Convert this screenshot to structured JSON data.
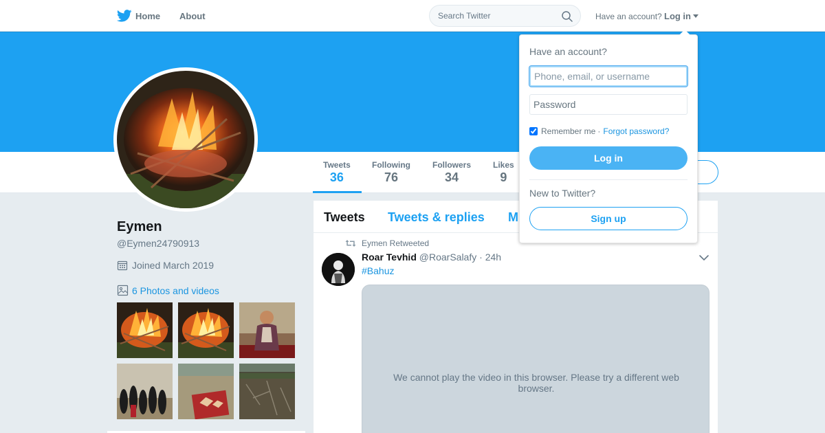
{
  "nav": {
    "home_label": "Home",
    "about_label": "About",
    "search_placeholder": "Search Twitter",
    "have_account_text": "Have an account?",
    "login_label": "Log in"
  },
  "colors": {
    "brand_blue": "#1da1f2",
    "link_blue": "#1b95e0",
    "login_button": "#4ab3f4",
    "background": "#e6ecf0"
  },
  "profile": {
    "name": "Eymen",
    "handle": "@Eymen24790913",
    "joined": "Joined March 2019",
    "photos_link": "6 Photos and videos"
  },
  "stats": [
    {
      "label": "Tweets",
      "value": "36",
      "active": true
    },
    {
      "label": "Following",
      "value": "76"
    },
    {
      "label": "Followers",
      "value": "34"
    },
    {
      "label": "Likes",
      "value": "9"
    }
  ],
  "timeline": {
    "tabs": [
      "Tweets",
      "Tweets & replies",
      "M"
    ],
    "retweet_label": "Eymen Retweeted",
    "tweet": {
      "author_name": "Roar Tevhid",
      "author_handle": "@RoarSalafy",
      "separator": "·",
      "time": "24h",
      "hashtag": "#Bahuz",
      "video_message": "We cannot play the video in this browser. Please try a different web browser."
    }
  },
  "login_dropdown": {
    "title": "Have an account?",
    "username_placeholder": "Phone, email, or username",
    "password_placeholder": "Password",
    "remember_label": "Remember me",
    "remember_separator": "·",
    "forgot_label": "Forgot password?",
    "login_button": "Log in",
    "new_text": "New to Twitter?",
    "signup_button": "Sign up"
  },
  "icons": {
    "logo": "twitter-bird-icon",
    "search": "search-icon",
    "calendar": "calendar-icon",
    "photo": "photo-icon",
    "retweet": "retweet-icon",
    "chevron": "chevron-down-icon"
  }
}
